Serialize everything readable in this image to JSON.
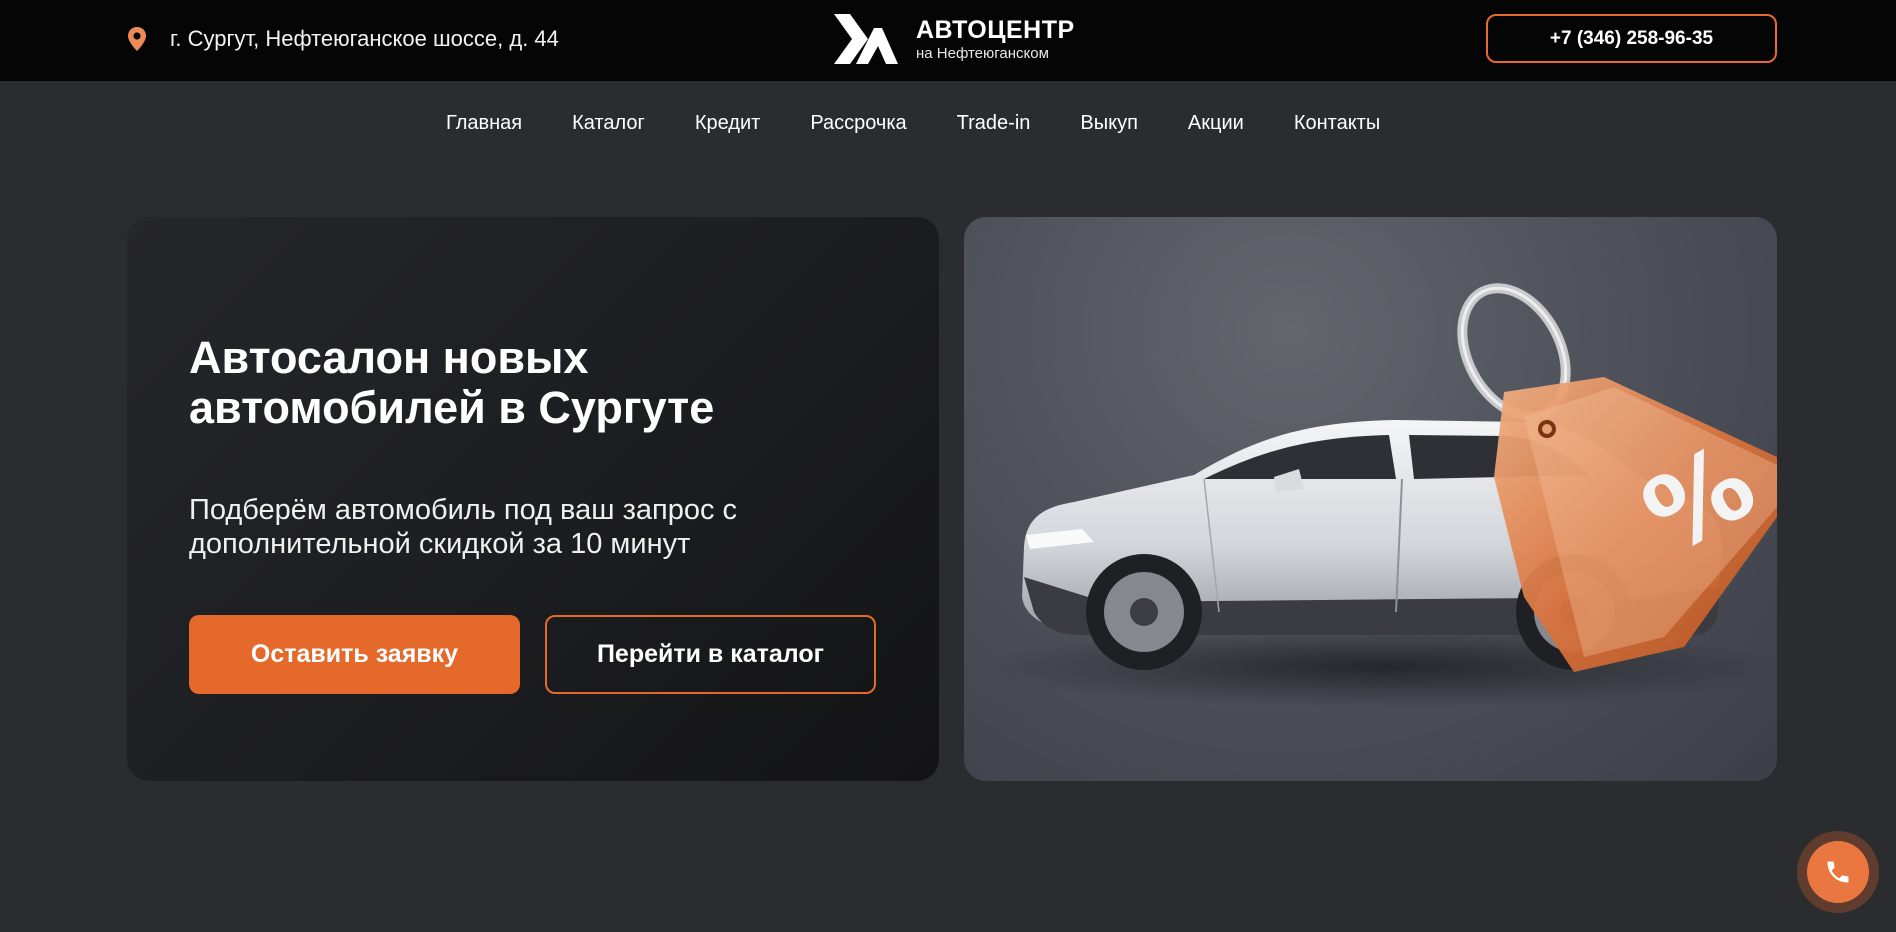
{
  "header": {
    "address": "г. Сургут, Нефтеюганское шоссе, д. 44",
    "logo_title": "АВТОЦЕНТР",
    "logo_subtitle": "на Нефтеюганском",
    "phone": "+7 (346) 258-96-35"
  },
  "nav": {
    "items": [
      {
        "label": "Главная"
      },
      {
        "label": "Каталог"
      },
      {
        "label": "Кредит"
      },
      {
        "label": "Рассрочка"
      },
      {
        "label": "Trade-in"
      },
      {
        "label": "Выкуп"
      },
      {
        "label": "Акции"
      },
      {
        "label": "Контакты"
      }
    ]
  },
  "hero": {
    "title_line1": "Автосалон новых",
    "title_line2": "автомобилей в Сургуте",
    "subtitle_line1": "Подберём автомобиль под ваш запрос с",
    "subtitle_line2": "дополнительной скидкой за 10 минут",
    "primary_button": "Оставить заявку",
    "secondary_button": "Перейти в каталог",
    "tag_symbol": "%"
  },
  "icons": {
    "location": "location-pin-icon",
    "call": "phone-icon"
  },
  "colors": {
    "accent": "#e5692b",
    "background": "#2b2c30",
    "topbar": "#050505"
  }
}
